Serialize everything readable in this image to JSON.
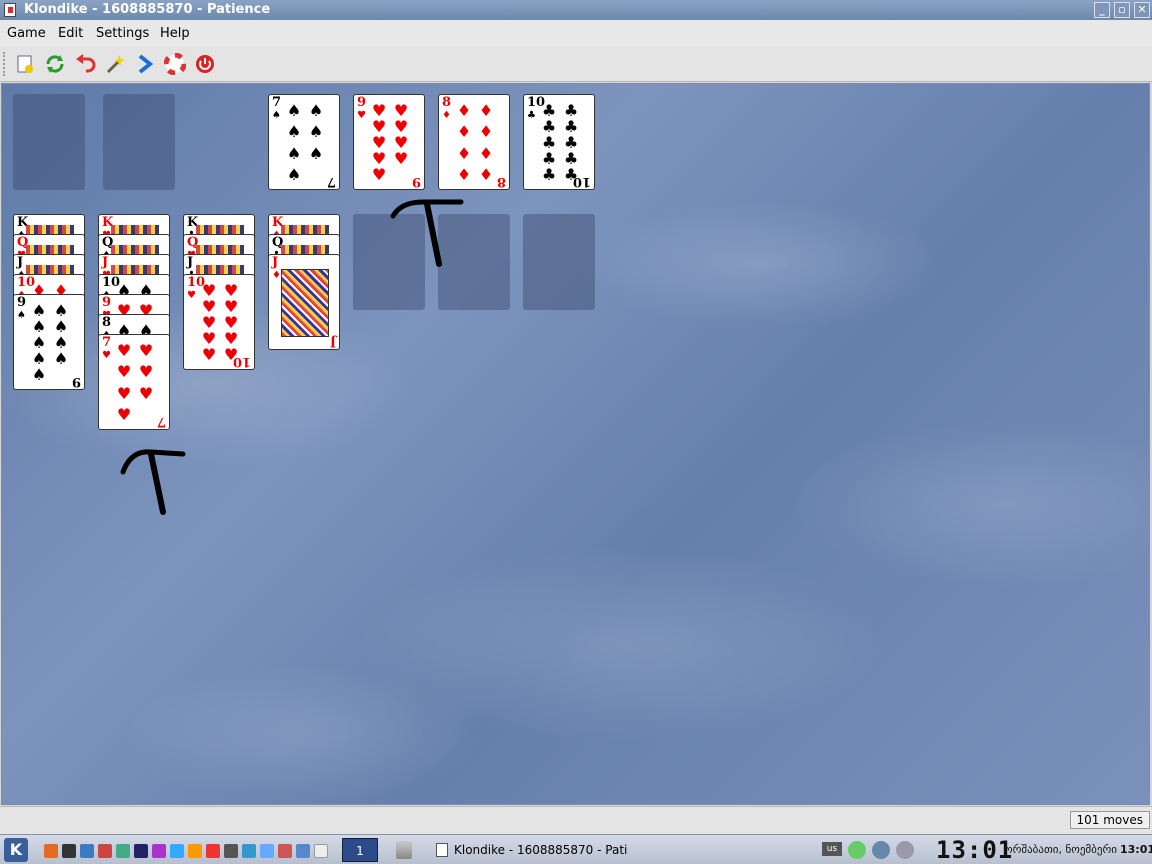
{
  "window": {
    "title": "Klondike - 1608885870 - Patience"
  },
  "menu": {
    "items": [
      "Game",
      "Edit",
      "Settings",
      "Help"
    ]
  },
  "toolbar": {
    "icons": [
      "new-game-icon",
      "restart-icon",
      "undo-icon",
      "hint-icon",
      "drop-icon",
      "help-icon",
      "quit-icon"
    ]
  },
  "board": {
    "stock": {
      "empty": true
    },
    "waste": {
      "empty": true
    },
    "foundations": [
      {
        "rank": "7",
        "suit": "♠",
        "color": "black"
      },
      {
        "rank": "9",
        "suit": "♥",
        "color": "red"
      },
      {
        "rank": "8",
        "suit": "♦",
        "color": "red"
      },
      {
        "rank": "10",
        "suit": "♣",
        "color": "black"
      }
    ],
    "tableau": [
      [
        {
          "rank": "K",
          "suit": "♠",
          "color": "black"
        },
        {
          "rank": "Q",
          "suit": "♥",
          "color": "red"
        },
        {
          "rank": "J",
          "suit": "♠",
          "color": "black"
        },
        {
          "rank": "10",
          "suit": "♦",
          "color": "red"
        },
        {
          "rank": "9",
          "suit": "♠",
          "color": "black"
        }
      ],
      [
        {
          "rank": "K",
          "suit": "♥",
          "color": "red"
        },
        {
          "rank": "Q",
          "suit": "♠",
          "color": "black"
        },
        {
          "rank": "J",
          "suit": "♥",
          "color": "red"
        },
        {
          "rank": "10",
          "suit": "♠",
          "color": "black"
        },
        {
          "rank": "9",
          "suit": "♥",
          "color": "red"
        },
        {
          "rank": "8",
          "suit": "♠",
          "color": "black"
        },
        {
          "rank": "7",
          "suit": "♥",
          "color": "red"
        }
      ],
      [
        {
          "rank": "K",
          "suit": "♣",
          "color": "black"
        },
        {
          "rank": "Q",
          "suit": "♥",
          "color": "red"
        },
        {
          "rank": "J",
          "suit": "♣",
          "color": "black"
        },
        {
          "rank": "10",
          "suit": "♥",
          "color": "red"
        }
      ],
      [
        {
          "rank": "K",
          "suit": "♦",
          "color": "red"
        },
        {
          "rank": "Q",
          "suit": "♣",
          "color": "black"
        },
        {
          "rank": "J",
          "suit": "♦",
          "color": "red"
        }
      ],
      [],
      [],
      []
    ]
  },
  "status": {
    "moves": "101 moves"
  },
  "taskbar": {
    "desktop_label": "1",
    "task_title": "Klondike - 1608885870 - Pati",
    "keyboard_layout": "us",
    "clock_big": "13:01",
    "date_text": "ორშაბათი, ნოემბერი",
    "time_text": "13:01"
  },
  "colors": {
    "red_suit": "#ee0000",
    "black_suit": "#000000",
    "background": "#6e88b4"
  }
}
